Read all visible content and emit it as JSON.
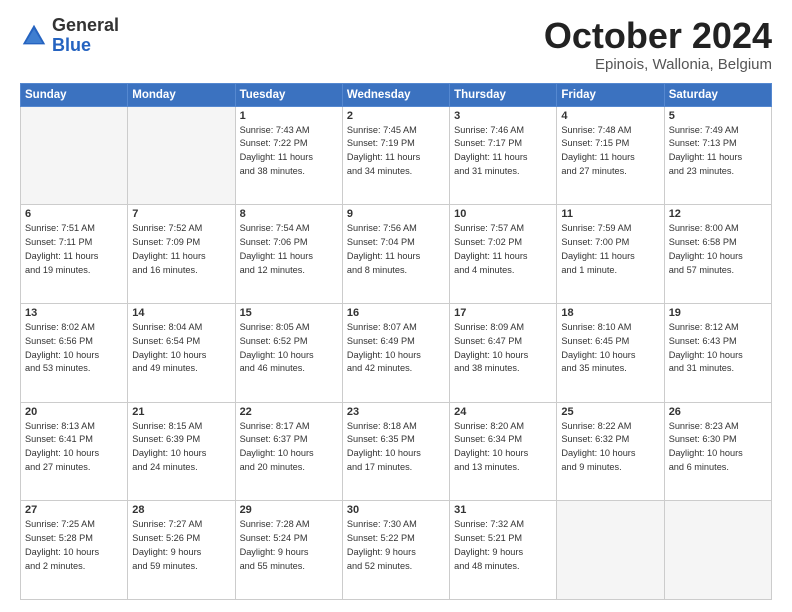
{
  "logo": {
    "general": "General",
    "blue": "Blue"
  },
  "title": "October 2024",
  "subtitle": "Epinois, Wallonia, Belgium",
  "header_days": [
    "Sunday",
    "Monday",
    "Tuesday",
    "Wednesday",
    "Thursday",
    "Friday",
    "Saturday"
  ],
  "weeks": [
    [
      {
        "day": "",
        "info": ""
      },
      {
        "day": "",
        "info": ""
      },
      {
        "day": "1",
        "info": "Sunrise: 7:43 AM\nSunset: 7:22 PM\nDaylight: 11 hours\nand 38 minutes."
      },
      {
        "day": "2",
        "info": "Sunrise: 7:45 AM\nSunset: 7:19 PM\nDaylight: 11 hours\nand 34 minutes."
      },
      {
        "day": "3",
        "info": "Sunrise: 7:46 AM\nSunset: 7:17 PM\nDaylight: 11 hours\nand 31 minutes."
      },
      {
        "day": "4",
        "info": "Sunrise: 7:48 AM\nSunset: 7:15 PM\nDaylight: 11 hours\nand 27 minutes."
      },
      {
        "day": "5",
        "info": "Sunrise: 7:49 AM\nSunset: 7:13 PM\nDaylight: 11 hours\nand 23 minutes."
      }
    ],
    [
      {
        "day": "6",
        "info": "Sunrise: 7:51 AM\nSunset: 7:11 PM\nDaylight: 11 hours\nand 19 minutes."
      },
      {
        "day": "7",
        "info": "Sunrise: 7:52 AM\nSunset: 7:09 PM\nDaylight: 11 hours\nand 16 minutes."
      },
      {
        "day": "8",
        "info": "Sunrise: 7:54 AM\nSunset: 7:06 PM\nDaylight: 11 hours\nand 12 minutes."
      },
      {
        "day": "9",
        "info": "Sunrise: 7:56 AM\nSunset: 7:04 PM\nDaylight: 11 hours\nand 8 minutes."
      },
      {
        "day": "10",
        "info": "Sunrise: 7:57 AM\nSunset: 7:02 PM\nDaylight: 11 hours\nand 4 minutes."
      },
      {
        "day": "11",
        "info": "Sunrise: 7:59 AM\nSunset: 7:00 PM\nDaylight: 11 hours\nand 1 minute."
      },
      {
        "day": "12",
        "info": "Sunrise: 8:00 AM\nSunset: 6:58 PM\nDaylight: 10 hours\nand 57 minutes."
      }
    ],
    [
      {
        "day": "13",
        "info": "Sunrise: 8:02 AM\nSunset: 6:56 PM\nDaylight: 10 hours\nand 53 minutes."
      },
      {
        "day": "14",
        "info": "Sunrise: 8:04 AM\nSunset: 6:54 PM\nDaylight: 10 hours\nand 49 minutes."
      },
      {
        "day": "15",
        "info": "Sunrise: 8:05 AM\nSunset: 6:52 PM\nDaylight: 10 hours\nand 46 minutes."
      },
      {
        "day": "16",
        "info": "Sunrise: 8:07 AM\nSunset: 6:49 PM\nDaylight: 10 hours\nand 42 minutes."
      },
      {
        "day": "17",
        "info": "Sunrise: 8:09 AM\nSunset: 6:47 PM\nDaylight: 10 hours\nand 38 minutes."
      },
      {
        "day": "18",
        "info": "Sunrise: 8:10 AM\nSunset: 6:45 PM\nDaylight: 10 hours\nand 35 minutes."
      },
      {
        "day": "19",
        "info": "Sunrise: 8:12 AM\nSunset: 6:43 PM\nDaylight: 10 hours\nand 31 minutes."
      }
    ],
    [
      {
        "day": "20",
        "info": "Sunrise: 8:13 AM\nSunset: 6:41 PM\nDaylight: 10 hours\nand 27 minutes."
      },
      {
        "day": "21",
        "info": "Sunrise: 8:15 AM\nSunset: 6:39 PM\nDaylight: 10 hours\nand 24 minutes."
      },
      {
        "day": "22",
        "info": "Sunrise: 8:17 AM\nSunset: 6:37 PM\nDaylight: 10 hours\nand 20 minutes."
      },
      {
        "day": "23",
        "info": "Sunrise: 8:18 AM\nSunset: 6:35 PM\nDaylight: 10 hours\nand 17 minutes."
      },
      {
        "day": "24",
        "info": "Sunrise: 8:20 AM\nSunset: 6:34 PM\nDaylight: 10 hours\nand 13 minutes."
      },
      {
        "day": "25",
        "info": "Sunrise: 8:22 AM\nSunset: 6:32 PM\nDaylight: 10 hours\nand 9 minutes."
      },
      {
        "day": "26",
        "info": "Sunrise: 8:23 AM\nSunset: 6:30 PM\nDaylight: 10 hours\nand 6 minutes."
      }
    ],
    [
      {
        "day": "27",
        "info": "Sunrise: 7:25 AM\nSunset: 5:28 PM\nDaylight: 10 hours\nand 2 minutes."
      },
      {
        "day": "28",
        "info": "Sunrise: 7:27 AM\nSunset: 5:26 PM\nDaylight: 9 hours\nand 59 minutes."
      },
      {
        "day": "29",
        "info": "Sunrise: 7:28 AM\nSunset: 5:24 PM\nDaylight: 9 hours\nand 55 minutes."
      },
      {
        "day": "30",
        "info": "Sunrise: 7:30 AM\nSunset: 5:22 PM\nDaylight: 9 hours\nand 52 minutes."
      },
      {
        "day": "31",
        "info": "Sunrise: 7:32 AM\nSunset: 5:21 PM\nDaylight: 9 hours\nand 48 minutes."
      },
      {
        "day": "",
        "info": ""
      },
      {
        "day": "",
        "info": ""
      }
    ]
  ]
}
